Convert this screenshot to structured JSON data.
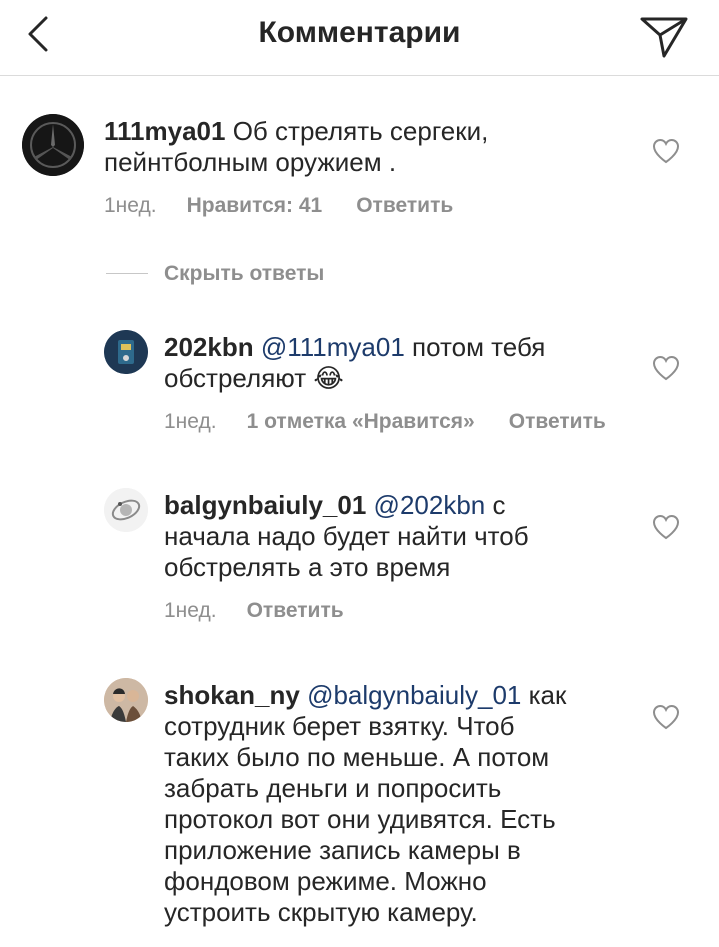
{
  "header": {
    "title": "Комментарии"
  },
  "comments": [
    {
      "username": "111mya01",
      "text_line1": " Об стрелять сергеки,",
      "text_line2": "пейнтболным оружием .",
      "time": "1нед.",
      "likes": "Нравится: 41",
      "reply": "Ответить"
    }
  ],
  "hide_replies": "Скрыть ответы",
  "replies": [
    {
      "username": "202kbn",
      "mention": "@111mya01",
      "text_line1_rest": " потом тебя",
      "text_line2": "обстреляют 😂",
      "time": "1нед.",
      "likes": "1 отметка «Нравится»",
      "reply": "Ответить"
    },
    {
      "username": "balgynbaiuly_01",
      "mention": "@202kbn",
      "text_line1_rest": " с",
      "text_line2": "начала надо будет найти чтоб",
      "text_line3": "обстрелять а это время",
      "time": "1нед.",
      "reply": "Ответить"
    },
    {
      "username": "shokan_ny",
      "mention": "@balgynbaiuly_01",
      "text_line1_rest": " как",
      "text_line2": "сотрудник берет взятку. Чтоб",
      "text_line3": "таких было по меньше. А потом",
      "text_line4": "забрать деньги и попросить",
      "text_line5": "протокол вот они удивятся. Есть",
      "text_line6": "приложение запись камеры в",
      "text_line7": "фондовом режиме. Можно",
      "text_line8": "устроить скрытую камеру."
    }
  ],
  "icons": {
    "back": "chevron-left-icon",
    "send": "paper-plane-icon",
    "like": "heart-outline-icon"
  },
  "colors": {
    "text": "#262626",
    "meta": "#8e8e8e",
    "mention": "#1d3b6b",
    "divider": "#dbdbdb"
  }
}
